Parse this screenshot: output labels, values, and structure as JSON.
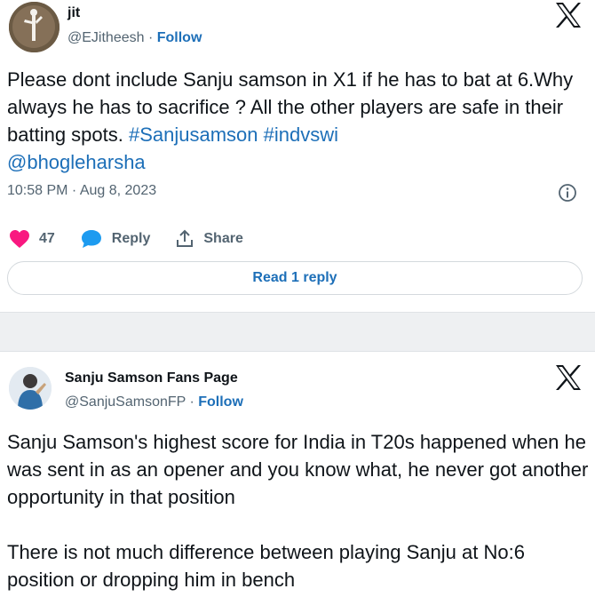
{
  "tweet1": {
    "display_name": "jit",
    "handle": "@EJitheesh",
    "follow_label": "Follow",
    "text_main": "Please dont include Sanju samson in X1 if he has to bat at 6.Why always he has to sacrifice ? All the other players are safe in their batting spots. ",
    "hashtag1": "#Sanjusamson",
    "hashtag2": "#indvswi",
    "mention": "@bhogleharsha",
    "timestamp": "10:58 PM · Aug 8, 2023",
    "like_count": "47",
    "reply_label": "Reply",
    "share_label": "Share",
    "read_reply_label": "Read 1 reply",
    "like_color": "#f91880",
    "reply_color": "#1d9bf0"
  },
  "tweet2": {
    "display_name": "Sanju Samson Fans Page",
    "handle": "@SanjuSamsonFP",
    "follow_label": "Follow",
    "paragraph1": "Sanju Samson's highest score for India in T20s happened when he was sent in as an opener and you know what, he never got another opportunity in that position",
    "paragraph2": "There is not much difference between playing Sanju at No:6 position or dropping him in bench"
  },
  "separator": " · ",
  "icons": [
    "x-logo-icon",
    "info-icon",
    "heart-icon",
    "reply-bubble-icon",
    "share-icon"
  ]
}
